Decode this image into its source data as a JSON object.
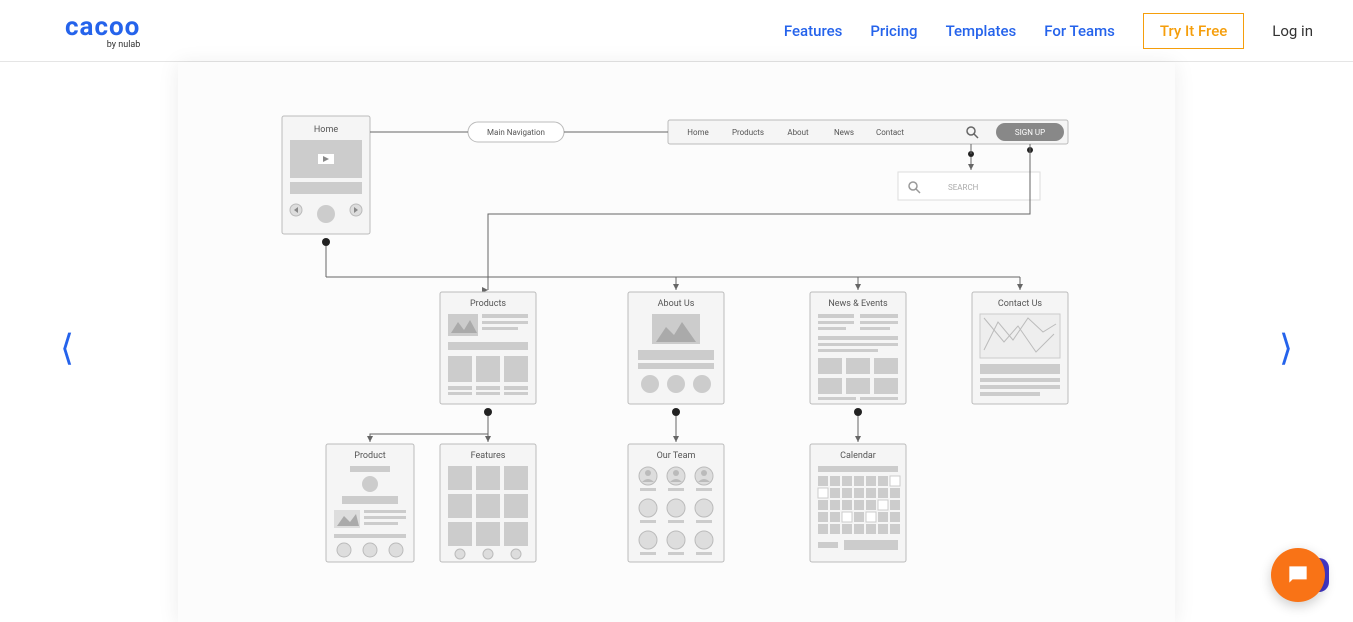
{
  "header": {
    "logo": "cacoo",
    "logo_sub": "by nulab",
    "nav": {
      "features": "Features",
      "pricing": "Pricing",
      "templates": "Templates",
      "for_teams": "For Teams",
      "try_free": "Try It Free",
      "login": "Log in"
    }
  },
  "diagram": {
    "home_card": "Home",
    "main_nav_pill": "Main Navigation",
    "navbar": {
      "items": [
        "Home",
        "Products",
        "About",
        "News",
        "Contact"
      ],
      "signup": "SIGN UP"
    },
    "search_box": "SEARCH",
    "cards": {
      "products": "Products",
      "about_us": "About Us",
      "news_events": "News & Events",
      "contact_us": "Contact Us",
      "product": "Product",
      "features": "Features",
      "our_team": "Our Team",
      "calendar": "Calendar"
    }
  }
}
